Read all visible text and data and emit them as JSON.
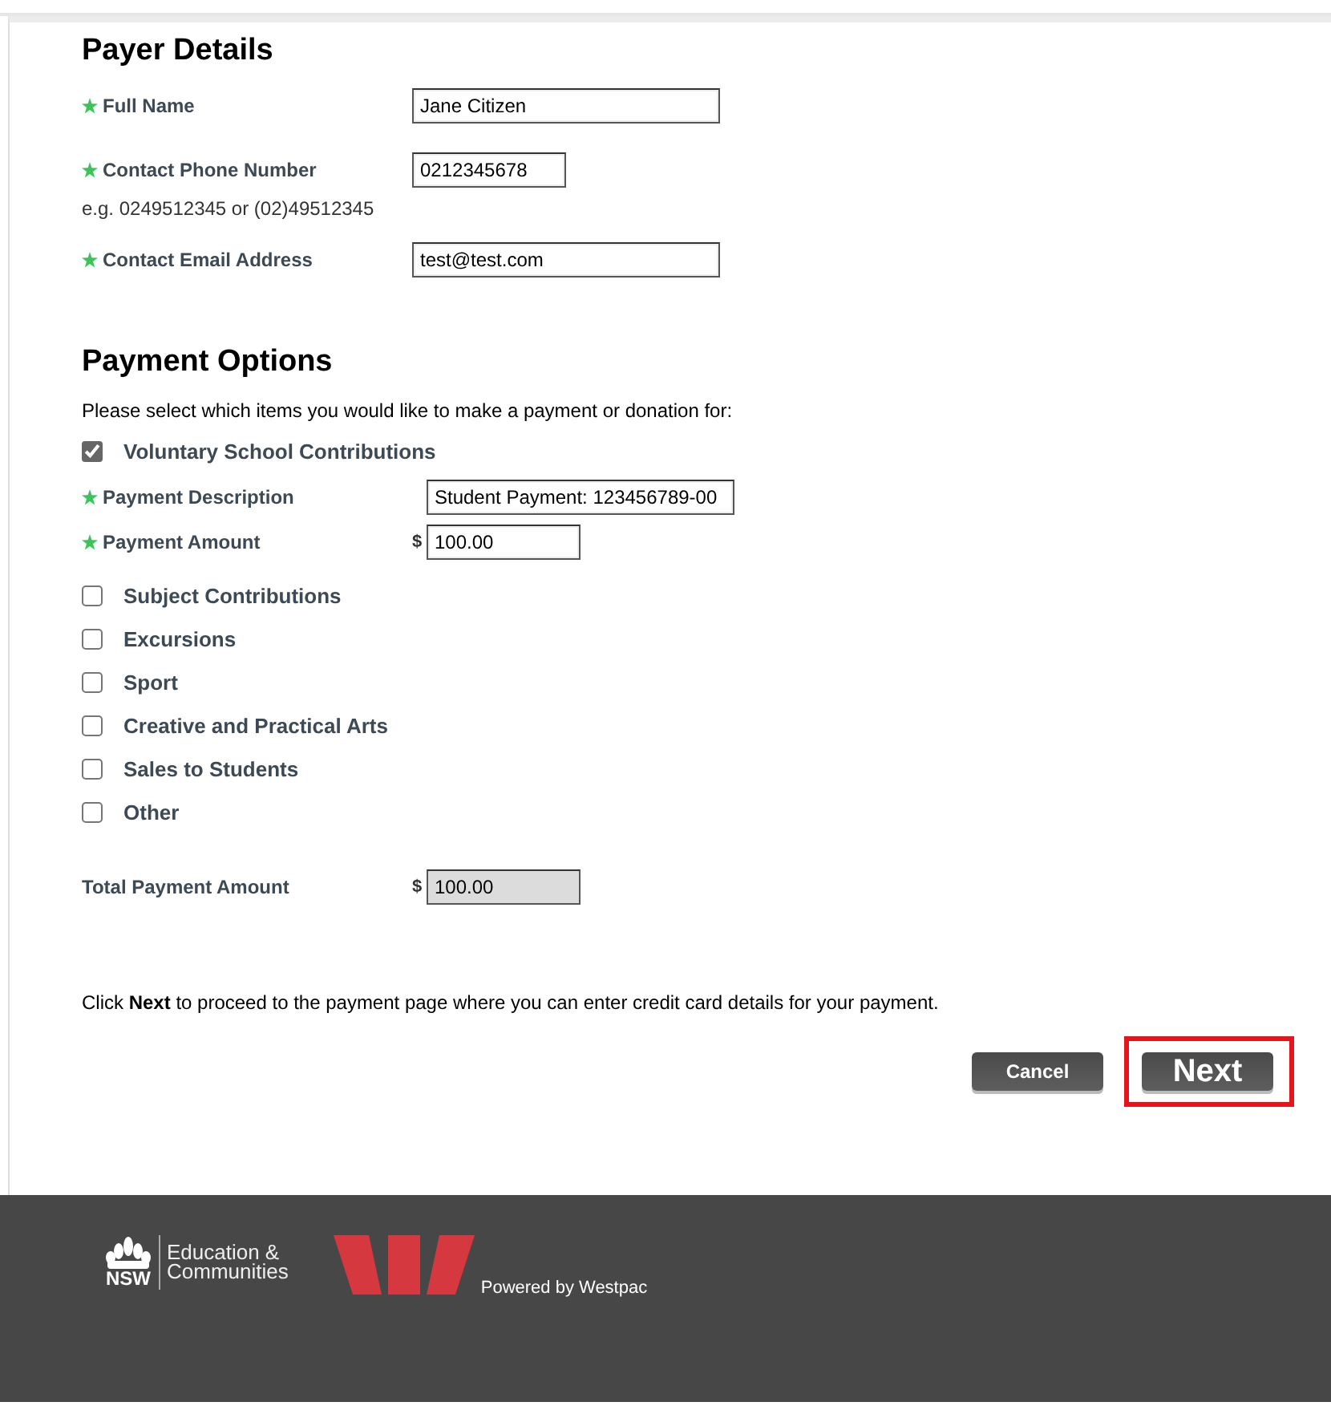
{
  "payer_details": {
    "heading": "Payer Details",
    "fields": [
      {
        "label": "Full Name",
        "required": true,
        "value": "Jane Citizen"
      },
      {
        "label": "Contact Phone Number",
        "required": true,
        "value": "0212345678",
        "hint": "e.g. 0249512345 or (02)49512345"
      },
      {
        "label": "Contact Email Address",
        "required": true,
        "value": "test@test.com"
      }
    ]
  },
  "payment_options": {
    "heading": "Payment Options",
    "intro": "Please select which items you would like to make a payment or donation for:",
    "items": [
      {
        "label": "Voluntary School Contributions",
        "checked": true,
        "fields": [
          {
            "label": "Payment Description",
            "required": true,
            "value": "Student Payment: 123456789-00"
          },
          {
            "label": "Payment Amount",
            "required": true,
            "currency": "$",
            "value": "100.00"
          }
        ]
      },
      {
        "label": "Subject Contributions",
        "checked": false
      },
      {
        "label": "Excursions",
        "checked": false
      },
      {
        "label": "Sport",
        "checked": false
      },
      {
        "label": "Creative and Practical Arts",
        "checked": false
      },
      {
        "label": "Sales to Students",
        "checked": false
      },
      {
        "label": "Other",
        "checked": false
      }
    ],
    "total": {
      "label": "Total Payment Amount",
      "currency": "$",
      "value": "100.00",
      "readonly": true
    }
  },
  "note": "Click **Next** to proceed to the payment page where you can enter credit card details for your payment.",
  "buttons": [
    {
      "label": "Cancel",
      "kind": "secondary",
      "highlighted": false
    },
    {
      "label": "Next",
      "kind": "primary",
      "highlighted": true
    }
  ],
  "footer": {
    "nsw_logo": {
      "short": "NSW",
      "line_1": "Education &",
      "line_2": "Communities"
    },
    "powered_by": "Powered by Westpac"
  }
}
